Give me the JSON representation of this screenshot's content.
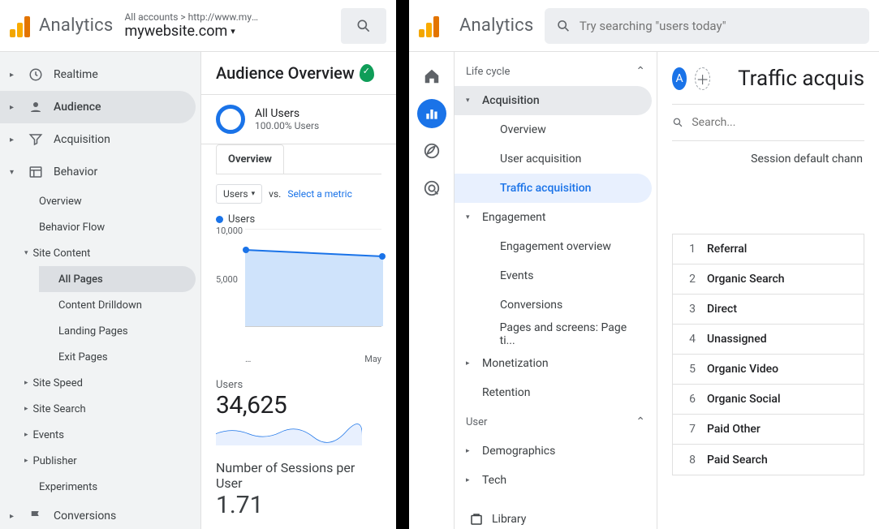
{
  "left": {
    "brand": "Analytics",
    "account_crumbs": "All accounts > http://www.mywebsit....",
    "site_name": "mywebsite.com",
    "nav": {
      "realtime": "Realtime",
      "audience": "Audience",
      "acquisition": "Acquisition",
      "behavior": "Behavior",
      "behavior_items": {
        "overview": "Overview",
        "flow": "Behavior Flow",
        "site_content": "Site Content",
        "sc_items": {
          "all_pages": "All Pages",
          "drilldown": "Content Drilldown",
          "landing": "Landing Pages",
          "exit": "Exit Pages"
        },
        "site_speed": "Site Speed",
        "site_search": "Site Search",
        "events": "Events",
        "publisher": "Publisher",
        "experiments": "Experiments"
      },
      "conversions": "Conversions"
    },
    "report": {
      "title": "Audience Overview",
      "seg_name": "All Users",
      "seg_sub": "100.00% Users",
      "tab": "Overview",
      "metric_sel": "Users",
      "vs": "vs.",
      "select_metric": "Select a metric",
      "legend": "Users",
      "y_10000": "10,000",
      "y_5000": "5,000",
      "x_start": "…",
      "x_end": "May",
      "m1_label": "Users",
      "m1_value": "34,625",
      "m2_label": "Number of Sessions per User",
      "m2_value": "1.71"
    }
  },
  "right": {
    "brand": "Analytics",
    "search_placeholder": "Try searching \"users today\"",
    "sections": {
      "lifecycle": "Life cycle",
      "acquisition": "Acquisition",
      "acq_items": {
        "overview": "Overview",
        "user_acq": "User acquisition",
        "traffic_acq": "Traffic acquisition"
      },
      "engagement": "Engagement",
      "eng_items": {
        "overview": "Engagement overview",
        "events": "Events",
        "conversions": "Conversions",
        "pages": "Pages and screens: Page ti..."
      },
      "monetization": "Monetization",
      "retention": "Retention",
      "user": "User",
      "demographics": "Demographics",
      "tech": "Tech",
      "library": "Library"
    },
    "main": {
      "avatar": "A",
      "title": "Traffic acquis",
      "search_placeholder": "Search...",
      "column": "Session default chann",
      "rows": [
        {
          "n": "1",
          "t": "Referral"
        },
        {
          "n": "2",
          "t": "Organic Search"
        },
        {
          "n": "3",
          "t": "Direct"
        },
        {
          "n": "4",
          "t": "Unassigned"
        },
        {
          "n": "5",
          "t": "Organic Video"
        },
        {
          "n": "6",
          "t": "Organic Social"
        },
        {
          "n": "7",
          "t": "Paid Other"
        },
        {
          "n": "8",
          "t": "Paid Search"
        }
      ]
    }
  },
  "chart_data": {
    "type": "line",
    "title": "Users",
    "categories": [
      "…",
      "May"
    ],
    "values": [
      7800,
      7200
    ],
    "ylim": [
      0,
      10000
    ],
    "y_ticks": [
      5000,
      10000
    ]
  }
}
